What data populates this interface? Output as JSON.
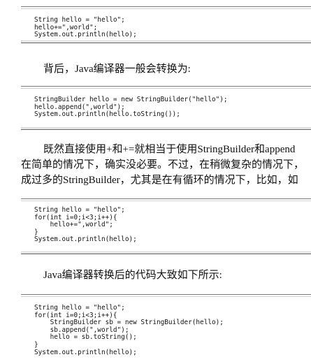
{
  "code_blocks": [
    {
      "lines": [
        "String hello = \"hello\";",
        "hello+=\",world\";",
        "System.out.println(hello);"
      ]
    },
    {
      "lines": [
        "StringBuilder hello = new StringBuilder(\"hello\");",
        "hello.append(\",world\");",
        "System.out.println(hello.toString());"
      ]
    },
    {
      "lines": [
        "String hello = \"hello\";",
        "for(int i=0;i<3;i++){",
        "    hello+=\",world\";",
        "}",
        "System.out.println(hello);"
      ]
    },
    {
      "lines": [
        "String hello = \"hello\";",
        "for(int i=0;i<3;i++){",
        "    StringBuilder sb = new StringBuilder(hello);",
        "    sb.append(\",world\");",
        "    hello = sb.toString();",
        "}",
        "System.out.println(hello);"
      ]
    }
  ],
  "paragraphs": [
    {
      "lines": [
        "背后，Java编译器一般会转换为:"
      ]
    },
    {
      "lines": [
        "既然直接使用+和+=就相当于使用StringBuilder和append",
        "在简单的情况下，确实没必要。不过，在稍微复杂的情况下，",
        "成过多的StringBuilder，尤其是在有循环的情况下，比如，如"
      ]
    },
    {
      "lines": [
        "Java编译器转换后的代码大致如下所示:"
      ]
    }
  ]
}
